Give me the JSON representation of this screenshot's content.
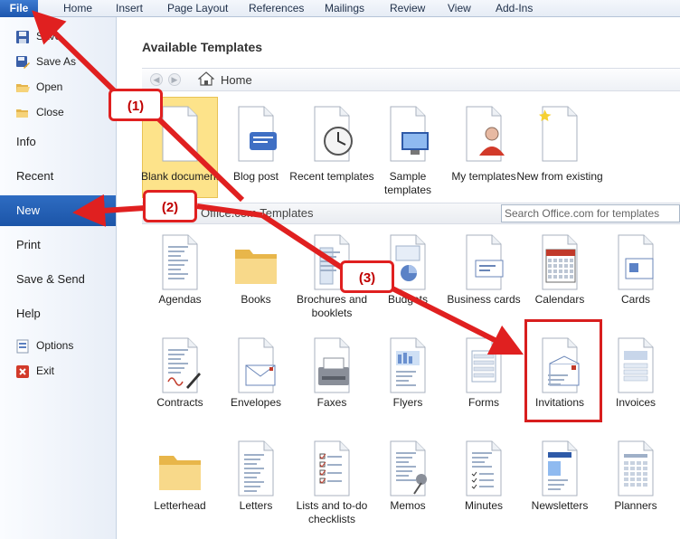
{
  "ribbon": {
    "file_label": "File",
    "tabs": [
      "Home",
      "Insert",
      "Page Layout",
      "References",
      "Mailings",
      "Review",
      "View",
      "Add-Ins"
    ]
  },
  "sidebar": {
    "save": "Save",
    "save_as": "Save As",
    "open": "Open",
    "close": "Close",
    "info": "Info",
    "recent": "Recent",
    "new": "New",
    "print": "Print",
    "save_send": "Save & Send",
    "help": "Help",
    "options": "Options",
    "exit": "Exit"
  },
  "main": {
    "heading": "Available Templates",
    "breadcrumb": "Home",
    "section_label": "Office.com Templates",
    "search_placeholder": "Search Office.com for templates",
    "top_row": [
      {
        "label": "Blank document",
        "icon": "blank-document-icon"
      },
      {
        "label": "Blog post",
        "icon": "blog-post-icon"
      },
      {
        "label": "Recent templates",
        "icon": "recent-templates-icon"
      },
      {
        "label": "Sample templates",
        "icon": "sample-templates-icon"
      },
      {
        "label": "My templates",
        "icon": "my-templates-icon"
      },
      {
        "label": "New from existing",
        "icon": "new-from-existing-icon"
      }
    ],
    "office_row1": [
      {
        "label": "Agendas",
        "icon": "agendas-icon"
      },
      {
        "label": "Books",
        "icon": "books-folder-icon"
      },
      {
        "label": "Brochures and booklets",
        "icon": "brochures-icon"
      },
      {
        "label": "Budgets",
        "icon": "budgets-icon"
      },
      {
        "label": "Business cards",
        "icon": "business-cards-icon"
      },
      {
        "label": "Calendars",
        "icon": "calendars-icon"
      },
      {
        "label": "Cards",
        "icon": "cards-icon"
      }
    ],
    "office_row2": [
      {
        "label": "Contracts",
        "icon": "contracts-icon"
      },
      {
        "label": "Envelopes",
        "icon": "envelopes-icon"
      },
      {
        "label": "Faxes",
        "icon": "faxes-icon"
      },
      {
        "label": "Flyers",
        "icon": "flyers-icon"
      },
      {
        "label": "Forms",
        "icon": "forms-icon"
      },
      {
        "label": "Invitations",
        "icon": "invitations-icon"
      },
      {
        "label": "Invoices",
        "icon": "invoices-icon"
      }
    ],
    "office_row3": [
      {
        "label": "Letterhead",
        "icon": "letterhead-folder-icon"
      },
      {
        "label": "Letters",
        "icon": "letters-icon"
      },
      {
        "label": "Lists and to-do checklists",
        "icon": "checklists-icon"
      },
      {
        "label": "Memos",
        "icon": "memos-icon"
      },
      {
        "label": "Minutes",
        "icon": "minutes-icon"
      },
      {
        "label": "Newsletters",
        "icon": "newsletters-icon"
      },
      {
        "label": "Planners",
        "icon": "planners-icon"
      }
    ]
  },
  "annotations": {
    "step1": "(1)",
    "step2": "(2)",
    "step3": "(3)",
    "color": "#e02020"
  },
  "colors": {
    "file_tab": "#2a66c0",
    "new_active": "#2462b8",
    "selected_tile": "#fde38a"
  }
}
